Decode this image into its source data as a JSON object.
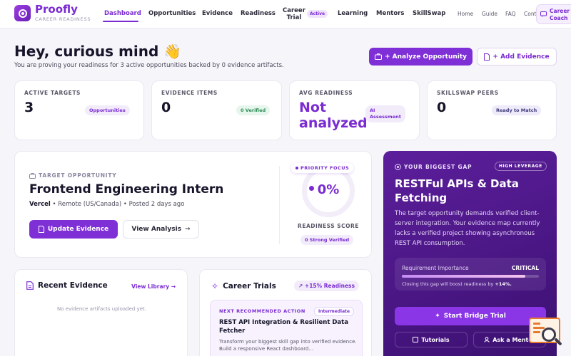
{
  "brand": {
    "name": "Proofly",
    "tagline": "CAREER READINESS"
  },
  "nav": {
    "dashboard": "Dashboard",
    "opportunities": "Opportunities",
    "evidence": "Evidence",
    "readiness": "Readiness",
    "career_trial_line1": "Career",
    "career_trial_line2": "Trial",
    "career_trial_badge": "Active",
    "learning": "Learning",
    "mentors": "Mentors",
    "skillswap": "SkillSwap",
    "home": "Home",
    "guide": "Guide",
    "faq": "FAQ",
    "contact": "Cont",
    "coach_line1": "Career",
    "coach_line2": "Coach"
  },
  "header": {
    "greeting": "Hey, curious mind 👋",
    "subtitle": "You are proving your readiness for 3 active opportunities backed by 0 evidence artifacts.",
    "analyze_button": "+ Analyze Opportunity",
    "add_evidence_button": "+ Add Evidence"
  },
  "stats": [
    {
      "label": "ACTIVE TARGETS",
      "value": "3",
      "badge": "Opportunities"
    },
    {
      "label": "EVIDENCE ITEMS",
      "value": "0",
      "badge": "0 Verified"
    },
    {
      "label": "AVG READINESS",
      "value_line1": "Not",
      "value_line2": "analyzed",
      "badge_line1": "AI",
      "badge_line2": "Assessment"
    },
    {
      "label": "SKILLSWAP PEERS",
      "value": "0",
      "badge": "Ready to Match"
    }
  ],
  "target": {
    "label": "TARGET OPPORTUNITY",
    "title": "Frontend Engineering Intern",
    "company": "Vercel",
    "location": "Remote (US/Canada)",
    "posted": "Posted 2 days ago",
    "update_button": "Update Evidence",
    "view_button": "View Analysis",
    "focus_badge": "PRIORITY FOCUS",
    "score": "0%",
    "score_label": "READINESS SCORE",
    "strong_verified": "0 Strong Verified"
  },
  "gap": {
    "label": "YOUR BIGGEST GAP",
    "leverage_badge": "HIGH LEVERAGE",
    "title": "RESTFul APIs & Data Fetching",
    "description": "The target opportunity demands verified client-server integration. Your evidence map currently lacks a verified project showing asynchronous REST API consumption.",
    "importance_label": "Requirement Importance",
    "importance_value": "CRITICAL",
    "importance_fill": 0.9,
    "note_prefix": "Closing this gap will boost readiness by ",
    "note_value": "+14%.",
    "bridge_button": "Start Bridge Trial",
    "tutorials_button": "Tutorials",
    "mentor_button": "Ask a Mentor"
  },
  "recent": {
    "title": "Recent Evidence",
    "link": "View Library →",
    "empty": "No evidence artifacts uploaded yet."
  },
  "trials": {
    "title": "Career Trials",
    "badge": "+15% Readiness",
    "next_label": "NEXT RECOMMENDED ACTION",
    "level": "Intermediate",
    "item_title": "REST API Integration & Resilient Data Fetcher",
    "item_desc": "Transform your biggest skill gap into verified evidence. Build a responsive React dashboard..."
  },
  "colors": {
    "accent": "#7a2bd1",
    "gap_bg": "#4a1684",
    "success": "#2e8b57",
    "widget": "#e67a2e"
  }
}
